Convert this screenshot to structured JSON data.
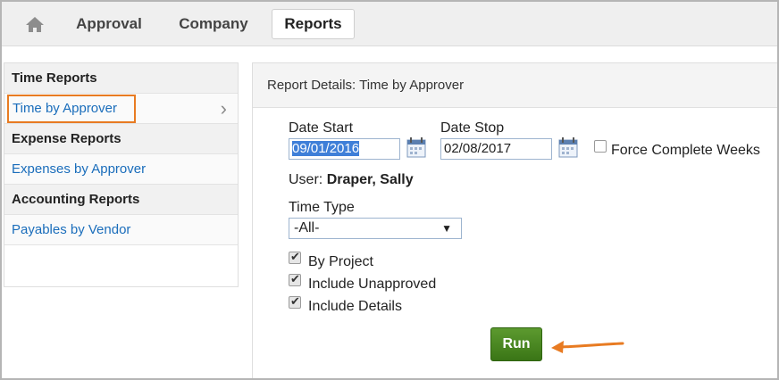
{
  "tabs": {
    "approval": "Approval",
    "company": "Company",
    "reports": "Reports"
  },
  "sidebar": {
    "sections": [
      {
        "heading": "Time Reports",
        "items": [
          "Time by Approver"
        ]
      },
      {
        "heading": "Expense Reports",
        "items": [
          "Expenses by Approver"
        ]
      },
      {
        "heading": "Accounting Reports",
        "items": [
          "Payables by Vendor"
        ]
      }
    ]
  },
  "panel": {
    "title": "Report Details: Time by Approver",
    "date_start_label": "Date Start",
    "date_start_value": "09/01/2016",
    "date_stop_label": "Date Stop",
    "date_stop_value": "02/08/2017",
    "force_complete_weeks_label": "Force Complete Weeks",
    "force_complete_weeks_checked": false,
    "user_label": "User:",
    "user_value": "Draper, Sally",
    "time_type_label": "Time Type",
    "time_type_value": "-All-",
    "checkboxes": [
      {
        "label": "By Project",
        "checked": true
      },
      {
        "label": "Include Unapproved",
        "checked": true
      },
      {
        "label": "Include Details",
        "checked": true
      }
    ],
    "run_label": "Run"
  },
  "icons": {
    "home": "home-icon",
    "calendar": "calendar-icon",
    "chevron": "chevron-right-icon",
    "arrow": "arrow-left-icon"
  },
  "colors": {
    "link": "#1a6dbb",
    "highlight": "#e87b22",
    "run_button": "#4a8a22",
    "annotation_arrow": "#e87b22"
  }
}
